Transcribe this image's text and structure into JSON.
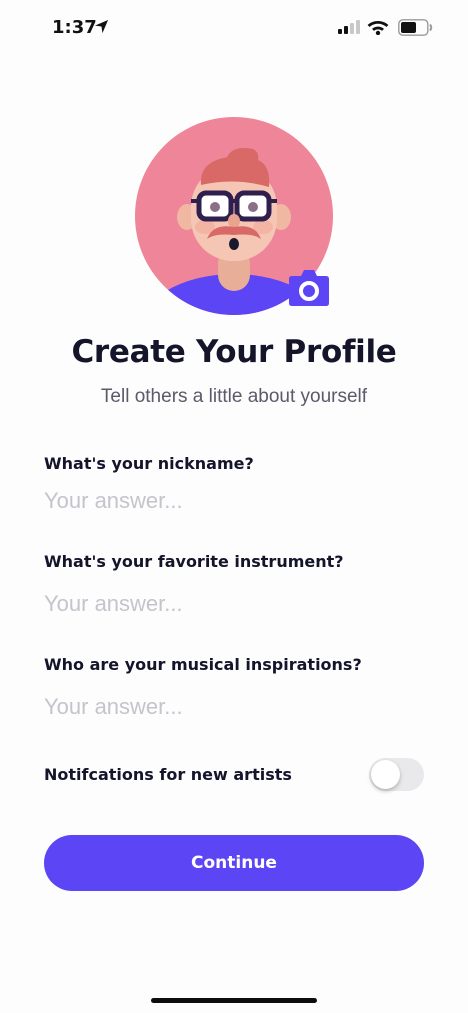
{
  "status_bar": {
    "time": "1:37",
    "icons": [
      "location-arrow-icon",
      "cellular-signal-icon",
      "wifi-icon",
      "battery-icon"
    ]
  },
  "profile": {
    "avatar_icon": "avatar-illustration",
    "camera_icon": "camera-icon",
    "title": "Create Your Profile",
    "subtitle": "Tell others a little about yourself"
  },
  "form": {
    "questions": [
      {
        "label": "What's your nickname?",
        "placeholder": "Your answer...",
        "value": ""
      },
      {
        "label": "What's your favorite instrument?",
        "placeholder": "Your answer...",
        "value": ""
      },
      {
        "label": "Who are your musical inspirations?",
        "placeholder": "Your answer...",
        "value": ""
      }
    ],
    "toggle_label": "Notifcations for new artists",
    "toggle_on": false
  },
  "actions": {
    "continue_label": "Continue"
  },
  "colors": {
    "accent": "#5B45F5",
    "avatar_bg": "#EF8598",
    "text": "#14142B",
    "placeholder": "#C4C4CC",
    "toggle_off": "#E9E9EC"
  }
}
